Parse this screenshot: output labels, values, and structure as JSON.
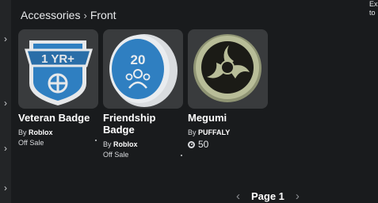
{
  "breadcrumb": {
    "parent": "Accessories",
    "current": "Front"
  },
  "corner": {
    "line1": "Ex",
    "line2": "to"
  },
  "items": [
    {
      "name": "Veteran Badge",
      "creator_prefix": "By",
      "creator": "Roblox",
      "price": "Off Sale",
      "image_text": "1 YR+",
      "icon": "veteran-badge-icon"
    },
    {
      "name": "Friendship Badge",
      "creator_prefix": "By",
      "creator": "Roblox",
      "price": "Off Sale",
      "image_text": "20",
      "icon": "friendship-badge-icon"
    },
    {
      "name": "Megumi",
      "creator_prefix": "By",
      "creator": "PUFFALY",
      "price": "50",
      "icon": "megumi-emblem-icon"
    }
  ],
  "pager": {
    "label": "Page 1"
  },
  "colors": {
    "badge_blue": "#2f7fc1",
    "badge_light": "#e9ecef",
    "emblem_green": "#b8bd98"
  }
}
